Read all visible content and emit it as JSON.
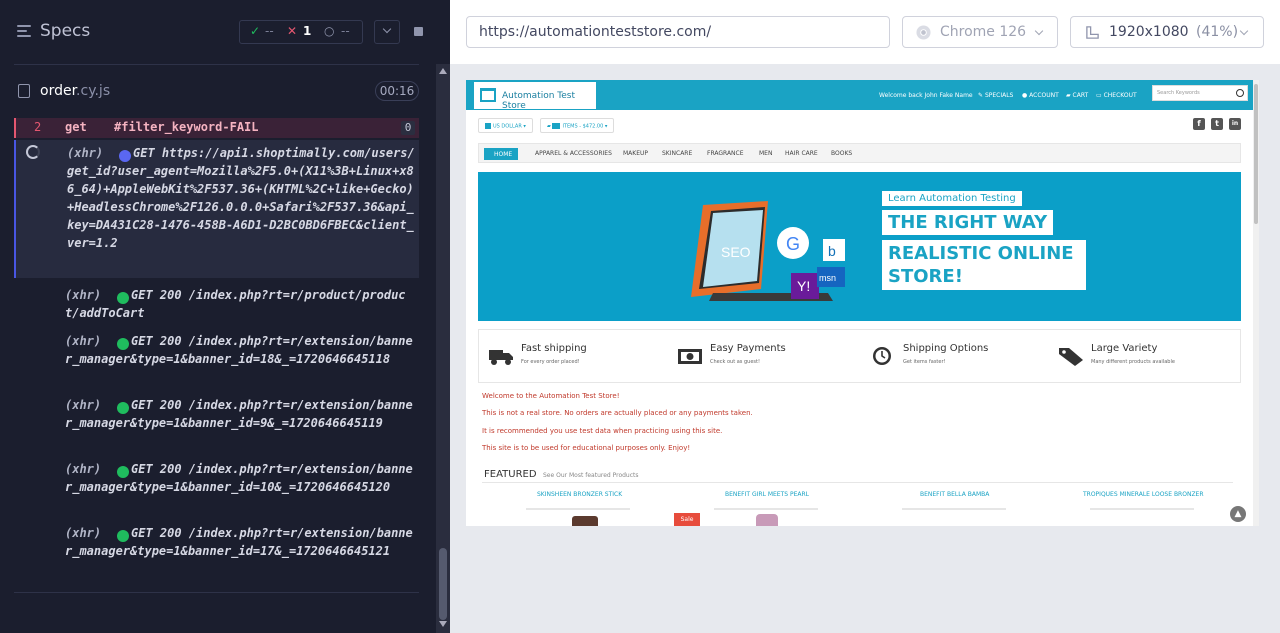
{
  "runner": {
    "specs_title": "Specs",
    "stats": {
      "passed": "--",
      "failed": "1",
      "pending": "--"
    },
    "spec_file": {
      "name": "order",
      "ext": ".cy.js",
      "time": "00:16"
    },
    "failed_command": {
      "number": "2",
      "name": "get",
      "selector": "#filter_keyword-FAIL",
      "badge": "0"
    },
    "xhr": [
      {
        "tag": "(xhr)",
        "status_color": "#5a67f2",
        "text": "GET https://api1.shoptimally.com/users/get_id?user_agent=Mozilla%2F5.0+(X11%3B+Linux+x86_64)+AppleWebKit%2F537.36+(KHTML%2C+like+Gecko)+HeadlessChrome%2F126.0.0.0+Safari%2F537.36&api_key=DA431C28-1476-458B-A6D1-D2BC0BD6FBEC&client_ver=1.2",
        "pending": true
      },
      {
        "tag": "(xhr)",
        "status_color": "#1fbc5e",
        "text": "GET 200 /index.php?rt=r/product/product/addToCart",
        "pending": false
      },
      {
        "tag": "(xhr)",
        "status_color": "#1fbc5e",
        "text": "GET 200 /index.php?rt=r/extension/banner_manager&type=1&banner_id=18&_=1720646645118",
        "pending": false
      },
      {
        "tag": "(xhr)",
        "status_color": "#1fbc5e",
        "text": "GET 200 /index.php?rt=r/extension/banner_manager&type=1&banner_id=9&_=1720646645119",
        "pending": false
      },
      {
        "tag": "(xhr)",
        "status_color": "#1fbc5e",
        "text": "GET 200 /index.php?rt=r/extension/banner_manager&type=1&banner_id=10&_=1720646645120",
        "pending": false
      },
      {
        "tag": "(xhr)",
        "status_color": "#1fbc5e",
        "text": "GET 200 /index.php?rt=r/extension/banner_manager&type=1&banner_id=17&_=1720646645121",
        "pending": false
      }
    ]
  },
  "aut": {
    "url": "https://automationteststore.com/",
    "browser": "Chrome 126",
    "viewport": "1920x1080",
    "viewport_scale": "(41%)"
  },
  "site": {
    "logo": "Automation Test Store",
    "welcome": "Welcome back John Fake Name",
    "nav": [
      "SPECIALS",
      "ACCOUNT",
      "CART",
      "CHECKOUT"
    ],
    "search_placeholder": "Search Keywords",
    "currency": "US DOLLAR",
    "cart_items": "ITEMS - $472.00",
    "cart_count": "16",
    "social": [
      "f",
      "t",
      "in"
    ],
    "menu": [
      "HOME",
      "APPAREL & ACCESSORIES",
      "MAKEUP",
      "SKINCARE",
      "FRAGRANCE",
      "MEN",
      "HAIR CARE",
      "BOOKS"
    ],
    "banner": {
      "small": "Learn Automation Testing",
      "big1": "THE RIGHT WAY",
      "big2": "REALISTIC ONLINE STORE!"
    },
    "features": [
      {
        "title": "Fast shipping",
        "sub": "For every order placed!"
      },
      {
        "title": "Easy Payments",
        "sub": "Check out as guest!"
      },
      {
        "title": "Shipping Options",
        "sub": "Get items faster!"
      },
      {
        "title": "Large Variety",
        "sub": "Many different products available"
      }
    ],
    "messages": [
      "Welcome to the Automation Test Store!",
      "This is not a real store. No orders are actually placed or any payments taken.",
      "It is recommended you use test data when practicing using this site.",
      "This site is to be used for educational purposes only. Enjoy!"
    ],
    "featured_title": "FEATURED",
    "featured_sub": "See Our Most featured Products",
    "products": [
      "SKINSHEEN BRONZER STICK",
      "BENEFIT GIRL MEETS PEARL",
      "BENEFIT BELLA BAMBA",
      "TROPIQUES MINERALE LOOSE BRONZER"
    ],
    "sale": "Sale"
  }
}
